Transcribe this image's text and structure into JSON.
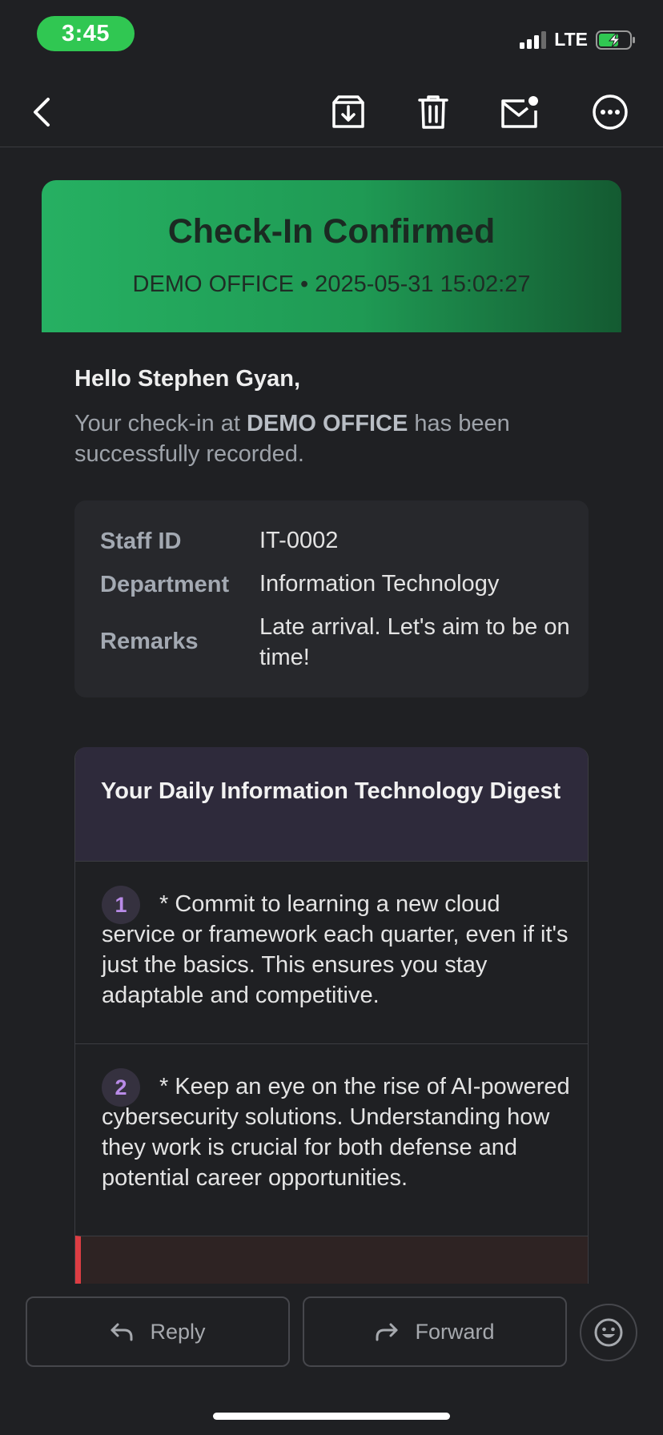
{
  "status_bar": {
    "time": "3:45",
    "network": "LTE",
    "battery_state": "charging",
    "colors": {
      "time_pill": "#30c752",
      "battery_fill": "#30c752"
    }
  },
  "toolbar": {
    "icons": [
      "back-icon",
      "archive-icon",
      "trash-icon",
      "mark-unread-icon",
      "more-icon"
    ]
  },
  "email": {
    "hero": {
      "title": "Check-In Confirmed",
      "subtitle": "DEMO OFFICE • 2025-05-31 15:02:27",
      "colors": {
        "gradient_start": "#26b062",
        "gradient_end": "#145a31"
      }
    },
    "greeting": "Hello Stephen Gyan,",
    "message": {
      "prefix": "Your check-in at ",
      "location": "DEMO OFFICE",
      "suffix": " has been successfully recorded."
    },
    "details": [
      {
        "label": "Staff ID",
        "value": "IT-0002"
      },
      {
        "label": "Department",
        "value": "Information Technology"
      },
      {
        "label": "Remarks",
        "value": "Late arrival. Let's aim to be on time!"
      }
    ],
    "digest": {
      "title": "Your Daily Information Technology Digest",
      "tips": [
        {
          "number": "1",
          "text": "* Commit to learning a new cloud service or framework each quarter, even if it's just the basics. This ensures you stay adaptable and competitive."
        },
        {
          "number": "2",
          "text": "* Keep an eye on the rise of AI-powered cybersecurity solutions. Understanding how they work is crucial for both defense and potential career opportunities."
        }
      ],
      "colors": {
        "number": "#b98be8",
        "alert_bar": "#dd3d43"
      }
    }
  },
  "actions": {
    "reply_label": "Reply",
    "forward_label": "Forward",
    "emoji_icon": "emoji-icon"
  }
}
